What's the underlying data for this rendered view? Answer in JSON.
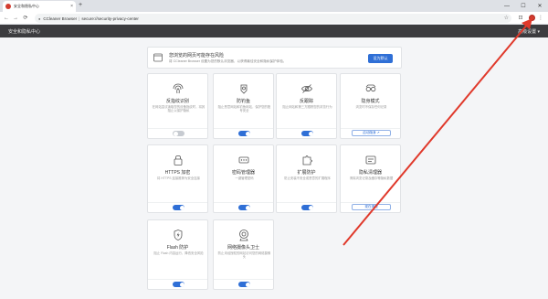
{
  "browser": {
    "tab_title": "安全和隐私中心",
    "tab_close": "×",
    "new_tab": "+",
    "window_controls": {
      "minimize": "—",
      "maximize": "☐",
      "close": "✕"
    },
    "nav": {
      "back": "←",
      "forward": "→",
      "reload": "⟳"
    },
    "url_host": "CCleaner Browser",
    "url_separator": "|",
    "url_path": "secure://security-privacy-center",
    "star": "☆",
    "menu_dots": "⋮"
  },
  "app": {
    "title": "安全和隐私中心",
    "menu_label": "高级设置 ▾"
  },
  "banner": {
    "title": "您浏览的网页可能存在风险",
    "desc": "将 CCleaner Browser 设置为您的默认浏览器，以获得最佳安全和隐私保护体验。",
    "button": "设为默认"
  },
  "cards": [
    {
      "icon": "fingerprint-icon",
      "title": "反指纹识别",
      "desc": "在网站尝试读取您的设备指纹时，将其阻止以保护隐私",
      "control": "toggle-off"
    },
    {
      "icon": "ad-block-icon",
      "title": "防钓鱼",
      "desc": "阻止恶意网站和钓鱼网站，保护您的账号安全",
      "control": "toggle-on"
    },
    {
      "icon": "eye-tracking-icon",
      "title": "反跟踪",
      "desc": "阻止网站和第三方跟踪您的浏览行为",
      "control": "toggle-on"
    },
    {
      "icon": "mask-icon",
      "title": "隐身模式",
      "desc": "浏览时不保存任何记录",
      "control": "button",
      "button": "启动隐身 ↗"
    },
    {
      "icon": "https-icon",
      "title": "HTTPS 加密",
      "desc": "将 HTTPS 连接推荐为安全连接",
      "control": "toggle-on"
    },
    {
      "icon": "password-icon",
      "title": "密码管理器",
      "desc": "一键管理密码",
      "control": "toggle-on"
    },
    {
      "icon": "extension-icon",
      "title": "扩展防护",
      "desc": "防止安装不安全或恶意的扩展程序",
      "control": "toggle-on"
    },
    {
      "icon": "cleaner-icon",
      "title": "隐私清理器",
      "desc": "清除浏览记录及缓存等隐私数据",
      "control": "button",
      "button": "现在清理"
    },
    {
      "icon": "flash-icon",
      "title": "Flash 防护",
      "desc": "阻止 Flash 内容运行，降低安全风险",
      "control": "toggle-on"
    },
    {
      "icon": "webcam-icon",
      "title": "网络摄像头卫士",
      "desc": "防止未经授权的网站访问您的网络摄像头",
      "control": "toggle-on"
    }
  ],
  "colors": {
    "accent": "#2f6fd6",
    "appbar": "#3c3c3f",
    "arrow": "#e0392b"
  }
}
